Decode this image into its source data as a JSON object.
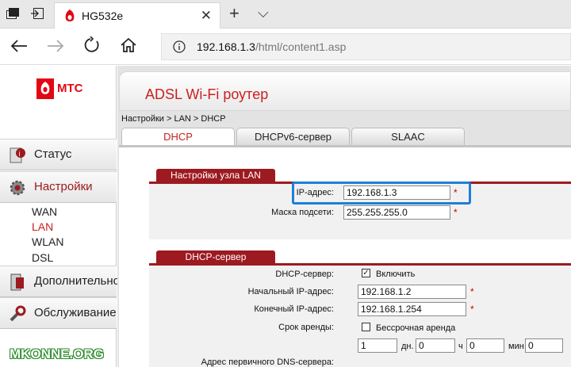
{
  "browser": {
    "tab_title": "HG532e",
    "tab_close": "✕",
    "new_tab": "+",
    "tab_menu": "⌵",
    "address_host": "192.168.1.3",
    "address_path": "/html/content1.asp"
  },
  "brand": {
    "logo_text": "МТС",
    "accent": "#e30613"
  },
  "header": {
    "title": "ADSL Wi-Fi роутер",
    "title_color": "#cc1f1f"
  },
  "breadcrumb": "Настройки > LAN > DHCP",
  "tabs": [
    "DHCP",
    "DHCPv6-сервер",
    "SLAAC"
  ],
  "sidebar": {
    "status": "Статус",
    "settings": "Настройки",
    "subitems": [
      "WAN",
      "LAN",
      "WLAN",
      "DSL"
    ],
    "advanced": "Дополнительно",
    "maintenance": "Обслуживание"
  },
  "lan": {
    "section_title": "Настройки узла LAN",
    "ip_label": "IP-адрес:",
    "ip_value": "192.168.1.3",
    "mask_label": "Маска подсети:",
    "mask_value": "255.255.255.0"
  },
  "dhcp": {
    "section_title": "DHCP-сервер",
    "server_label": "DHCP-сервер:",
    "enable_label": "Включить",
    "enabled": true,
    "start_label": "Начальный IP-адрес:",
    "start_value": "192.168.1.2",
    "end_label": "Конечный IP-адрес:",
    "end_value": "192.168.1.254",
    "lease_label": "Срок аренды:",
    "unlimited_label": "Бессрочная аренда",
    "days_value": "1",
    "days_label": "дн.",
    "hours_value": "0",
    "hours_label": "ч",
    "minutes_value": "0",
    "minutes_label": "мин",
    "seconds_value": "0",
    "dns_label": "Адрес первичного DNS-сервера:"
  },
  "required_mark": "*",
  "highlight_color": "#1e7fd6",
  "watermark": "MKONNE.ORG"
}
